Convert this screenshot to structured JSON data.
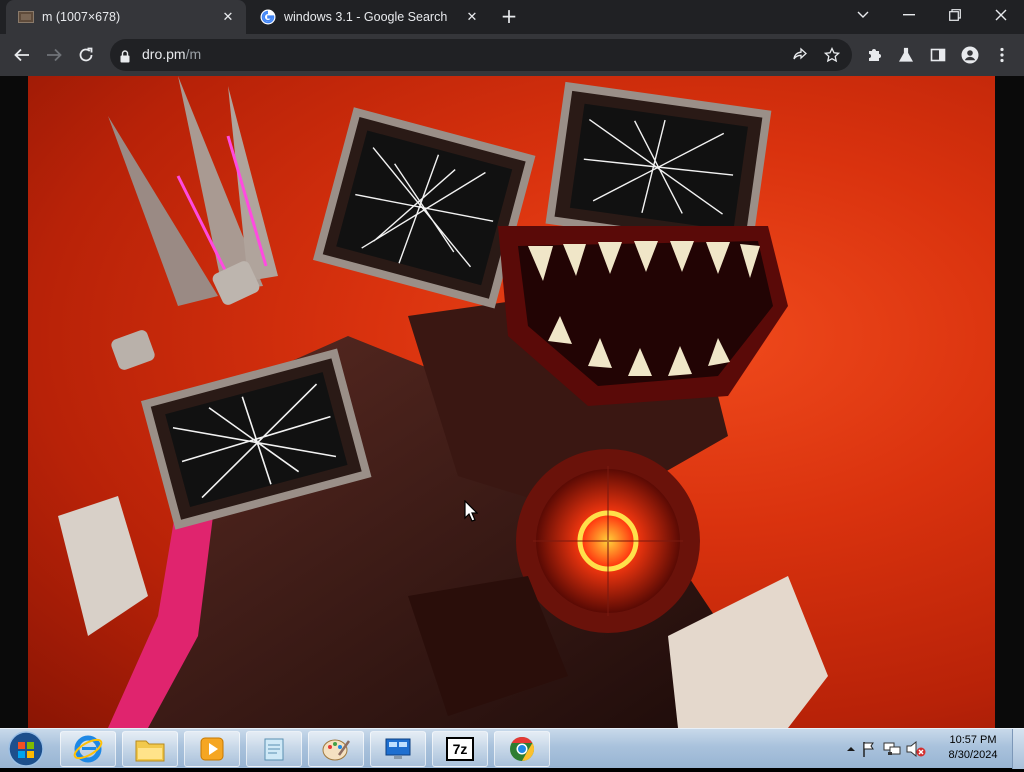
{
  "browser": {
    "tabs": [
      {
        "title": "m (1007×678)",
        "active": true,
        "favicon": "image-thumbnail-icon"
      },
      {
        "title": "windows 3.1 - Google Search",
        "active": false,
        "favicon": "google-icon"
      }
    ],
    "new_tab_label": "+",
    "address": {
      "host": "dro.pm",
      "path": "/m"
    }
  },
  "page": {
    "content": "image of a red-background illustration: monster with cracked TV-screen heads, jaws with sharp teeth and a glowing red core"
  },
  "taskbar": {
    "pinned": [
      "internet-explorer-icon",
      "file-explorer-icon",
      "media-player-icon",
      "notepad-icon",
      "paint-icon",
      "remote-desktop-icon",
      "7zip-icon",
      "chrome-icon"
    ],
    "sevenzip_label": "7z",
    "clock": {
      "time": "10:57 PM",
      "date": "8/30/2024"
    }
  },
  "colors": {
    "tabstrip": "#202124",
    "toolbar": "#35363a",
    "image_red": "#d9320e",
    "taskbar": "#a9c2dc"
  }
}
